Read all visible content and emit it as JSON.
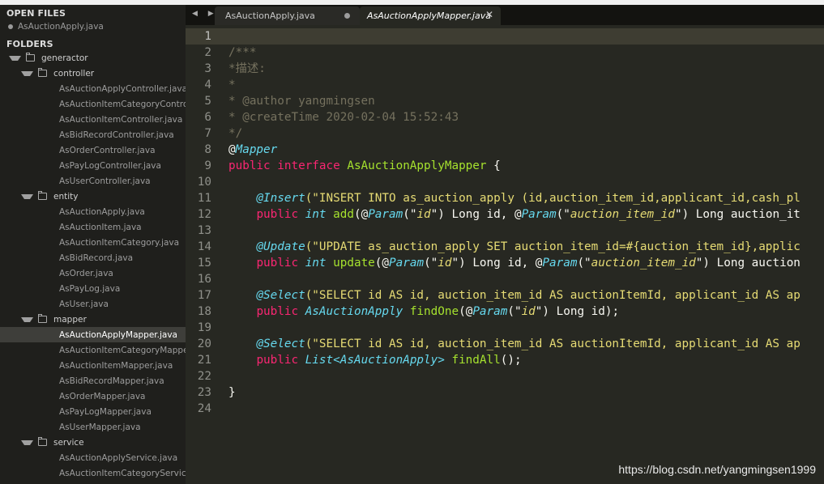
{
  "sidebar": {
    "open_files_heading": "OPEN FILES",
    "open_file": "AsAuctionApply.java",
    "folders_heading": "FOLDERS",
    "tree": [
      {
        "label": "generactor",
        "kind": "folder",
        "depth": 0
      },
      {
        "label": "controller",
        "kind": "folder",
        "depth": 1
      },
      {
        "label": "AsAuctionApplyController.java",
        "kind": "file",
        "depth": 2
      },
      {
        "label": "AsAuctionItemCategoryController.java",
        "kind": "file",
        "depth": 2
      },
      {
        "label": "AsAuctionItemController.java",
        "kind": "file",
        "depth": 2
      },
      {
        "label": "AsBidRecordController.java",
        "kind": "file",
        "depth": 2
      },
      {
        "label": "AsOrderController.java",
        "kind": "file",
        "depth": 2
      },
      {
        "label": "AsPayLogController.java",
        "kind": "file",
        "depth": 2
      },
      {
        "label": "AsUserController.java",
        "kind": "file",
        "depth": 2
      },
      {
        "label": "entity",
        "kind": "folder",
        "depth": 1
      },
      {
        "label": "AsAuctionApply.java",
        "kind": "file",
        "depth": 2
      },
      {
        "label": "AsAuctionItem.java",
        "kind": "file",
        "depth": 2
      },
      {
        "label": "AsAuctionItemCategory.java",
        "kind": "file",
        "depth": 2
      },
      {
        "label": "AsBidRecord.java",
        "kind": "file",
        "depth": 2
      },
      {
        "label": "AsOrder.java",
        "kind": "file",
        "depth": 2
      },
      {
        "label": "AsPayLog.java",
        "kind": "file",
        "depth": 2
      },
      {
        "label": "AsUser.java",
        "kind": "file",
        "depth": 2
      },
      {
        "label": "mapper",
        "kind": "folder",
        "depth": 1
      },
      {
        "label": "AsAuctionApplyMapper.java",
        "kind": "file",
        "depth": 2,
        "selected": true
      },
      {
        "label": "AsAuctionItemCategoryMapper.java",
        "kind": "file",
        "depth": 2
      },
      {
        "label": "AsAuctionItemMapper.java",
        "kind": "file",
        "depth": 2
      },
      {
        "label": "AsBidRecordMapper.java",
        "kind": "file",
        "depth": 2
      },
      {
        "label": "AsOrderMapper.java",
        "kind": "file",
        "depth": 2
      },
      {
        "label": "AsPayLogMapper.java",
        "kind": "file",
        "depth": 2
      },
      {
        "label": "AsUserMapper.java",
        "kind": "file",
        "depth": 2
      },
      {
        "label": "service",
        "kind": "folder",
        "depth": 1
      },
      {
        "label": "AsAuctionApplyService.java",
        "kind": "file",
        "depth": 2
      },
      {
        "label": "AsAuctionItemCategoryService.java",
        "kind": "file",
        "depth": 2
      }
    ]
  },
  "tabs": [
    {
      "label": "AsAuctionApply.java",
      "modified": true,
      "active": false
    },
    {
      "label": "AsAuctionApplyMapper.java",
      "modified": false,
      "active": true
    }
  ],
  "editor": {
    "active_line": 1,
    "lines": [
      [],
      [
        {
          "t": "/***",
          "c": "c"
        }
      ],
      [
        {
          "t": "*描述:",
          "c": "c"
        }
      ],
      [
        {
          "t": "*",
          "c": "c"
        }
      ],
      [
        {
          "t": "* @author yangmingsen",
          "c": "c"
        }
      ],
      [
        {
          "t": "* @createTime 2020-02-04 15:52:43",
          "c": "c"
        }
      ],
      [
        {
          "t": "*/",
          "c": "c"
        }
      ],
      [
        {
          "t": "@",
          "c": ""
        },
        {
          "t": "Mapper",
          "c": "a"
        }
      ],
      [
        {
          "t": "public",
          "c": "k"
        },
        {
          "t": " ",
          "c": ""
        },
        {
          "t": "interface",
          "c": "k"
        },
        {
          "t": " ",
          "c": ""
        },
        {
          "t": "AsAuctionApplyMapper",
          "c": "cl"
        },
        {
          "t": " {",
          "c": ""
        }
      ],
      [],
      [
        {
          "t": "    ",
          "c": ""
        },
        {
          "t": "@Insert",
          "c": "a"
        },
        {
          "t": "(\"INSERT INTO as_auction_apply (id,auction_item_id,applicant_id,cash_pl",
          "c": "s"
        }
      ],
      [
        {
          "t": "    ",
          "c": ""
        },
        {
          "t": "public",
          "c": "k"
        },
        {
          "t": " ",
          "c": ""
        },
        {
          "t": "int",
          "c": "t"
        },
        {
          "t": " ",
          "c": ""
        },
        {
          "t": "add",
          "c": "fn"
        },
        {
          "t": "(@",
          "c": ""
        },
        {
          "t": "Param",
          "c": "a"
        },
        {
          "t": "(\"",
          "c": ""
        },
        {
          "t": "id",
          "c": "si"
        },
        {
          "t": "\") Long id, @",
          "c": ""
        },
        {
          "t": "Param",
          "c": "a"
        },
        {
          "t": "(\"",
          "c": ""
        },
        {
          "t": "auction_item_id",
          "c": "si"
        },
        {
          "t": "\") Long auction_it",
          "c": ""
        }
      ],
      [],
      [
        {
          "t": "    ",
          "c": ""
        },
        {
          "t": "@Update",
          "c": "a"
        },
        {
          "t": "(\"UPDATE as_auction_apply SET auction_item_id=#{auction_item_id},applic",
          "c": "s"
        }
      ],
      [
        {
          "t": "    ",
          "c": ""
        },
        {
          "t": "public",
          "c": "k"
        },
        {
          "t": " ",
          "c": ""
        },
        {
          "t": "int",
          "c": "t"
        },
        {
          "t": " ",
          "c": ""
        },
        {
          "t": "update",
          "c": "fn"
        },
        {
          "t": "(@",
          "c": ""
        },
        {
          "t": "Param",
          "c": "a"
        },
        {
          "t": "(\"",
          "c": ""
        },
        {
          "t": "id",
          "c": "si"
        },
        {
          "t": "\") Long id, @",
          "c": ""
        },
        {
          "t": "Param",
          "c": "a"
        },
        {
          "t": "(\"",
          "c": ""
        },
        {
          "t": "auction_item_id",
          "c": "si"
        },
        {
          "t": "\") Long auction",
          "c": ""
        }
      ],
      [],
      [
        {
          "t": "    ",
          "c": ""
        },
        {
          "t": "@Select",
          "c": "a"
        },
        {
          "t": "(\"SELECT id AS id, auction_item_id AS auctionItemId, applicant_id AS ap",
          "c": "s"
        }
      ],
      [
        {
          "t": "    ",
          "c": ""
        },
        {
          "t": "public",
          "c": "k"
        },
        {
          "t": " ",
          "c": ""
        },
        {
          "t": "AsAuctionApply",
          "c": "t"
        },
        {
          "t": " ",
          "c": ""
        },
        {
          "t": "findOne",
          "c": "fn"
        },
        {
          "t": "(@",
          "c": ""
        },
        {
          "t": "Param",
          "c": "a"
        },
        {
          "t": "(\"",
          "c": ""
        },
        {
          "t": "id",
          "c": "si"
        },
        {
          "t": "\") Long id);",
          "c": ""
        }
      ],
      [],
      [
        {
          "t": "    ",
          "c": ""
        },
        {
          "t": "@Select",
          "c": "a"
        },
        {
          "t": "(\"SELECT id AS id, auction_item_id AS auctionItemId, applicant_id AS ap",
          "c": "s"
        }
      ],
      [
        {
          "t": "    ",
          "c": ""
        },
        {
          "t": "public",
          "c": "k"
        },
        {
          "t": " ",
          "c": ""
        },
        {
          "t": "List<AsAuctionApply>",
          "c": "t"
        },
        {
          "t": " ",
          "c": ""
        },
        {
          "t": "findAll",
          "c": "fn"
        },
        {
          "t": "();",
          "c": ""
        }
      ],
      [],
      [
        {
          "t": "}",
          "c": ""
        }
      ],
      []
    ]
  },
  "watermark": "https://blog.csdn.net/yangmingsen1999",
  "colors": {
    "editor_bg": "#272822",
    "sidebar_bg": "#1f1f1c",
    "keyword": "#f92672",
    "type": "#66d9ef",
    "string": "#e6db74",
    "function": "#a6e22e",
    "comment": "#75715e"
  }
}
